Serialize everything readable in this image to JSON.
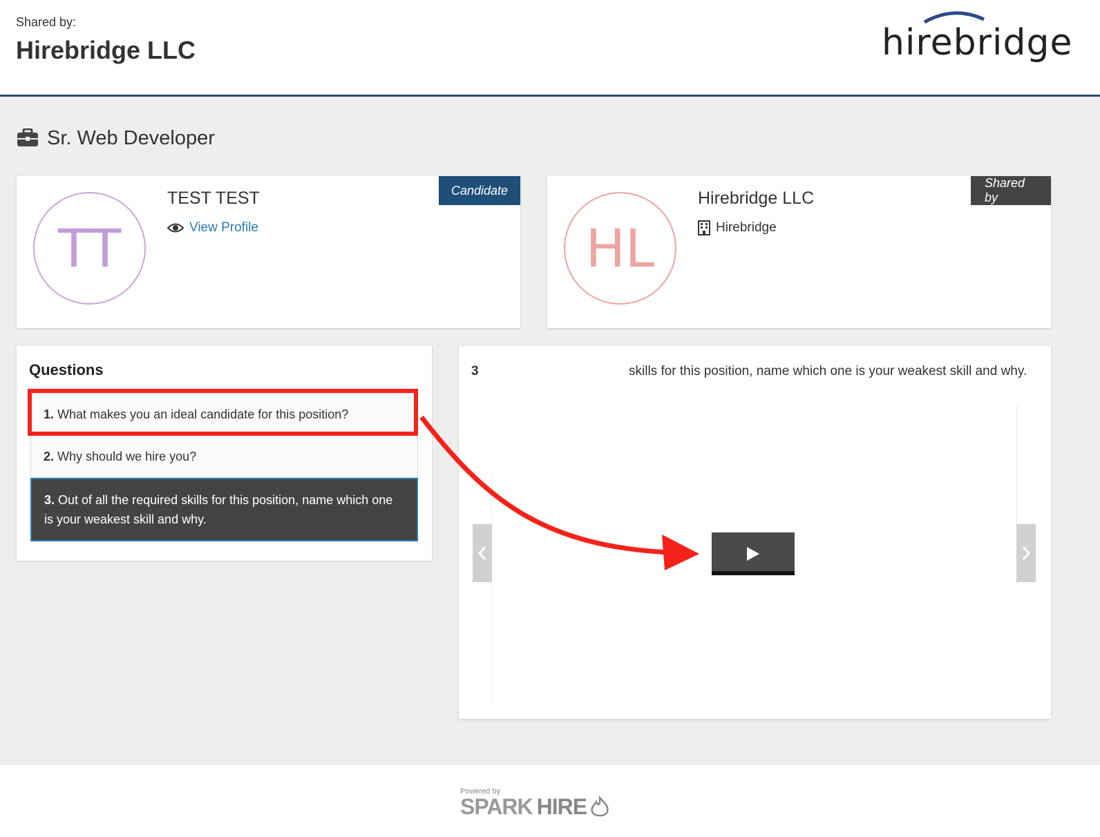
{
  "header": {
    "shared_by_label": "Shared by:",
    "company_name": "Hirebridge LLC",
    "logo_text": "hirebridge"
  },
  "job": {
    "icon": "briefcase-icon",
    "title": "Sr. Web Developer"
  },
  "candidate_card": {
    "badge": "Candidate",
    "initials": "TT",
    "name": "TEST TEST",
    "link_icon": "eye-icon",
    "link_label": "View Profile"
  },
  "shared_card": {
    "badge": "Shared by",
    "initials": "HL",
    "name": "Hirebridge LLC",
    "org_icon": "building-icon",
    "org": "Hirebridge"
  },
  "questions": {
    "title": "Questions",
    "items": [
      {
        "num": "1.",
        "text": "What makes you an ideal candidate for this position?"
      },
      {
        "num": "2.",
        "text": "Why should we hire you?"
      },
      {
        "num": "3.",
        "text": "Out of all the required skills for this position, name which one is your weakest skill and why."
      }
    ],
    "active_index": 2
  },
  "player": {
    "title_num": "3",
    "title_text": "skills for this position, name which one is your weakest skill and why."
  },
  "footer": {
    "powered_by": "Powered by",
    "brand_spark": "SPARK",
    "brand_hire": "HIRE"
  },
  "colors": {
    "header_rule": "#2c4a6e",
    "candidate_badge": "#1f4e79",
    "shared_badge": "#444444",
    "link": "#2b7bb9",
    "annotation_red": "#f5221a"
  }
}
